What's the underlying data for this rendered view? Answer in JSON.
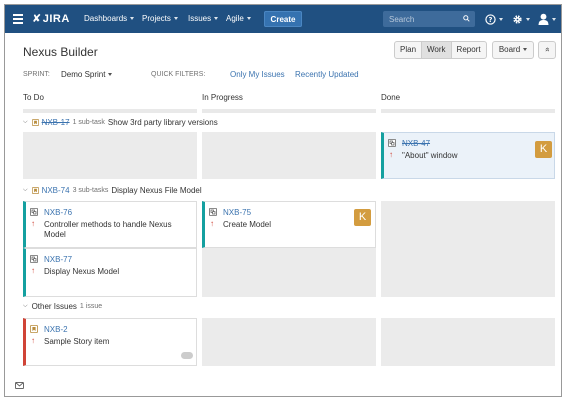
{
  "nav": {
    "logo": "JIRA",
    "dashboards": "Dashboards",
    "projects": "Projects",
    "issues": "Issues",
    "agile": "Agile",
    "create": "Create",
    "search_placeholder": "Search",
    "icons": [
      "menu-icon",
      "search-icon",
      "help-icon",
      "settings-icon",
      "user-avatar-icon"
    ]
  },
  "board": {
    "title": "Nexus Builder",
    "sprint_label": "SPRINT:",
    "sprint_value": "Demo Sprint",
    "quick_filters_label": "QUICK FILTERS:",
    "quick_filters": [
      "Only My Issues",
      "Recently Updated"
    ],
    "modes": [
      "Plan",
      "Work",
      "Report"
    ],
    "active_mode": "Work",
    "board_menu": "Board",
    "collapse_symbol": "»"
  },
  "columns": [
    "To Do",
    "In Progress",
    "Done"
  ],
  "swimlanes": [
    {
      "key": "NXB-17",
      "count": "1 sub-task",
      "summary": "Show 3rd party library versions",
      "resolved": true,
      "cards": {
        "done": [
          {
            "key": "NXB-47",
            "summary": "\"About\" window",
            "avatar": "K",
            "resolved": true
          }
        ]
      }
    },
    {
      "key": "NXB-74",
      "count": "3 sub-tasks",
      "summary": "Display Nexus File Model",
      "resolved": false,
      "cards": {
        "todo": [
          {
            "key": "NXB-76",
            "summary": "Controller methods to handle Nexus Model"
          },
          {
            "key": "NXB-77",
            "summary": "Display Nexus Model"
          }
        ],
        "in_progress": [
          {
            "key": "NXB-75",
            "summary": "Create Model",
            "avatar": "K"
          }
        ]
      }
    },
    {
      "title": "Other Issues",
      "count": "1 issue",
      "cards": {
        "todo": [
          {
            "key": "NXB-2",
            "summary": "Sample Story item"
          }
        ]
      }
    }
  ],
  "colors": {
    "nav_bg": "#205081",
    "link": "#3b73af",
    "priority": "#d04437",
    "card_selected": "#ebf2f9",
    "avatar_bg": "#d39c3f"
  }
}
